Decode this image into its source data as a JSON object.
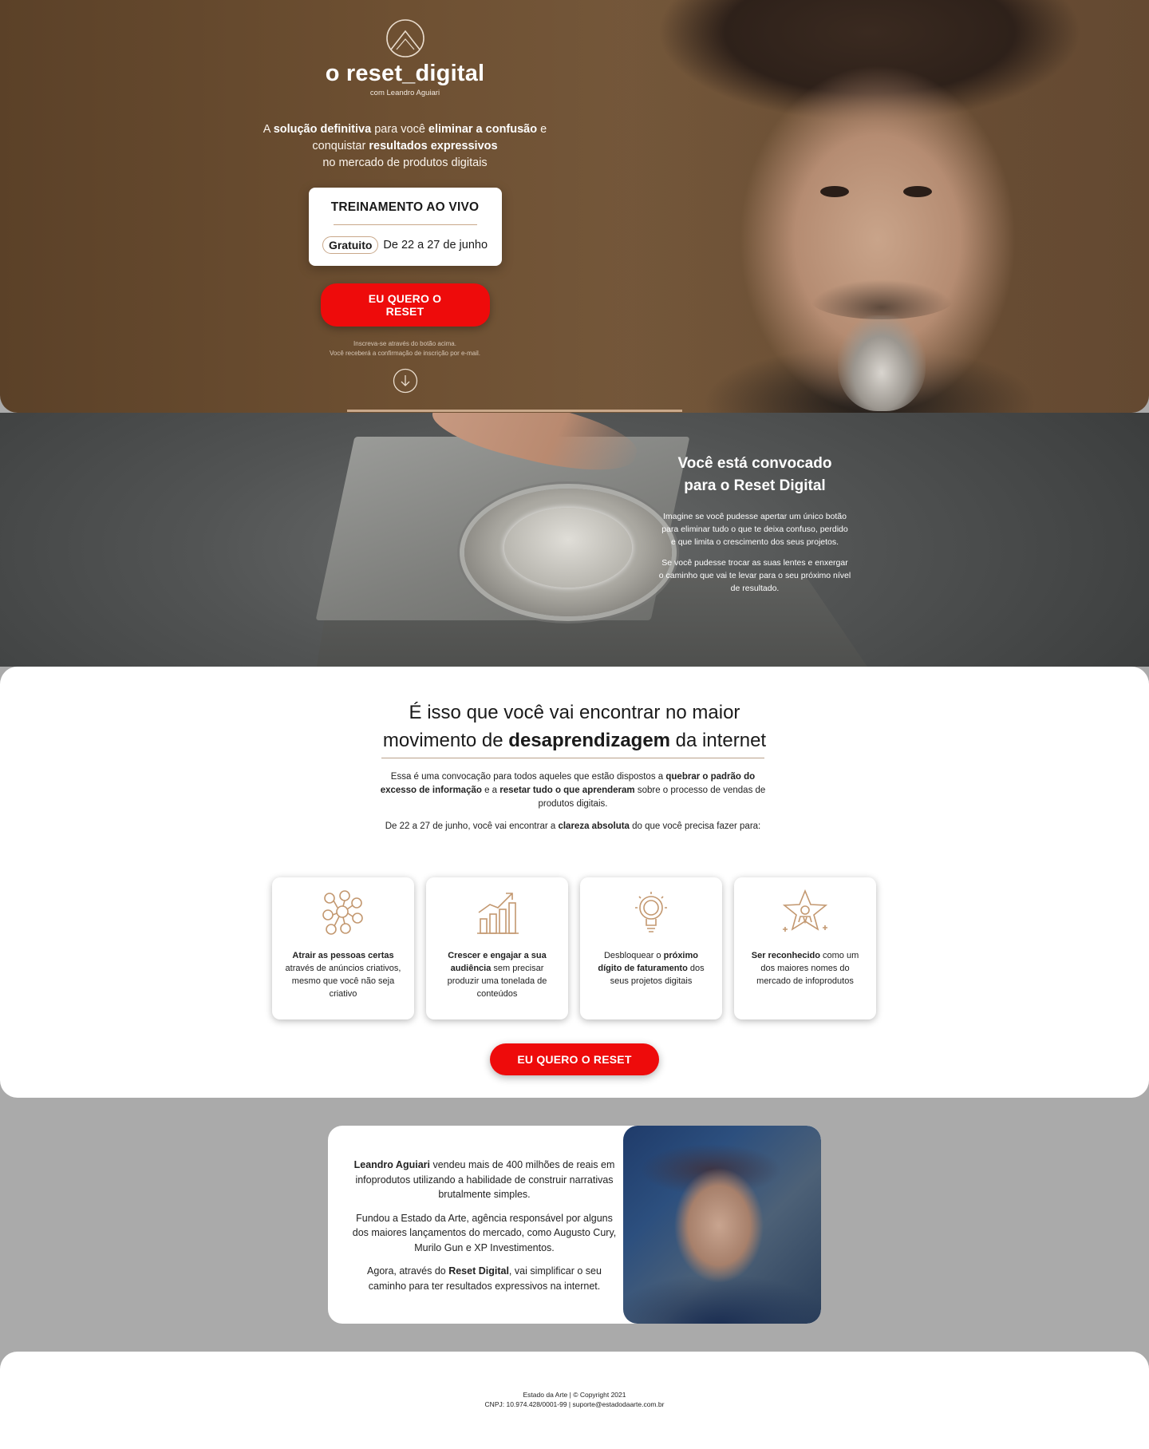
{
  "hero": {
    "brand_name": "o reset_digital",
    "brand_sub": "com Leandro Aguiari",
    "lead": {
      "a": "A ",
      "b1": "solução definitiva",
      "c": " para você ",
      "b2": "eliminar a confusão",
      "d": " e conquistar ",
      "b3": "resultados expressivos",
      "e": " no mercado de produtos digitais"
    },
    "live_card": {
      "title": "TREINAMENTO AO VIVO",
      "badge": "Gratuito",
      "dates": "De 22 a 27 de junho"
    },
    "cta": "EU QUERO O RESET",
    "note_1": "Inscreva-se através do botão acima.",
    "note_2": "Você receberá a confirmação de inscrição por e-mail."
  },
  "convocado": {
    "title_1": "Você está convocado",
    "title_2": "para o Reset Digital",
    "p1": "Imagine se você pudesse apertar um único botão para eliminar tudo o que te deixa confuso, perdido e que limita o crescimento dos seus projetos.",
    "p2": "Se você pudesse trocar as suas lentes e enxergar o caminho que vai te levar para o seu próximo nível de resultado."
  },
  "movimento": {
    "title_1": "É isso que você vai encontrar no maior",
    "title_2a": "movimento de ",
    "title_2b": "desaprendizagem",
    "title_2c": " da internet",
    "p1": {
      "a": "Essa é uma convocação para todos aqueles que estão dispostos a ",
      "b1": "quebrar o padrão do excesso de informação",
      "c": " e a ",
      "b2": "resetar tudo o que aprenderam",
      "d": " sobre o processo de vendas de produtos digitais."
    },
    "p2": {
      "a": "De 22 a 27 de junho, você vai encontrar a ",
      "b": "clareza absoluta",
      "c": " do que você precisa fazer para:"
    },
    "cards": [
      {
        "icon": "people-network-icon",
        "bold": "Atrair as pessoas certas",
        "rest": " através de anúncios criativos, mesmo que você não seja criativo"
      },
      {
        "icon": "growth-chart-icon",
        "bold": "Crescer e engajar a sua audiência",
        "rest": " sem precisar produzir uma tonelada de conteúdos"
      },
      {
        "icon": "lightbulb-icon",
        "pre": "Desbloquear o ",
        "bold": "próximo dígito de faturamento",
        "rest": " dos seus projetos digitais"
      },
      {
        "icon": "star-person-icon",
        "bold": "Ser reconhecido",
        "rest": " como um dos maiores nomes do mercado de infoprodutos"
      }
    ],
    "cta": "EU QUERO O RESET"
  },
  "bio": {
    "p1_bold": "Leandro Aguiari",
    "p1_rest": " vendeu mais de 400 milhões de reais em infoprodutos utilizando a habilidade de construir narrativas brutalmente simples.",
    "p2": "Fundou a Estado da Arte, agência responsável por alguns dos maiores lançamentos do mercado, como Augusto Cury, Murilo Gun e XP Investimentos.",
    "p3_a": "Agora, através do ",
    "p3_bold": "Reset Digital",
    "p3_c": ", vai simplificar o seu caminho para ter resultados expressivos na internet."
  },
  "footer": {
    "line_1": "Estado da Arte | © Copyright 2021",
    "line_2": "CNPJ: 10.974.428/0001-99 | suporte@estadodaarte.com.br"
  },
  "colors": {
    "accent_red": "#ee0b0b",
    "gold": "#c9a88a",
    "hero_brown": "#6e5032",
    "page_gray": "#aaaaaa"
  }
}
